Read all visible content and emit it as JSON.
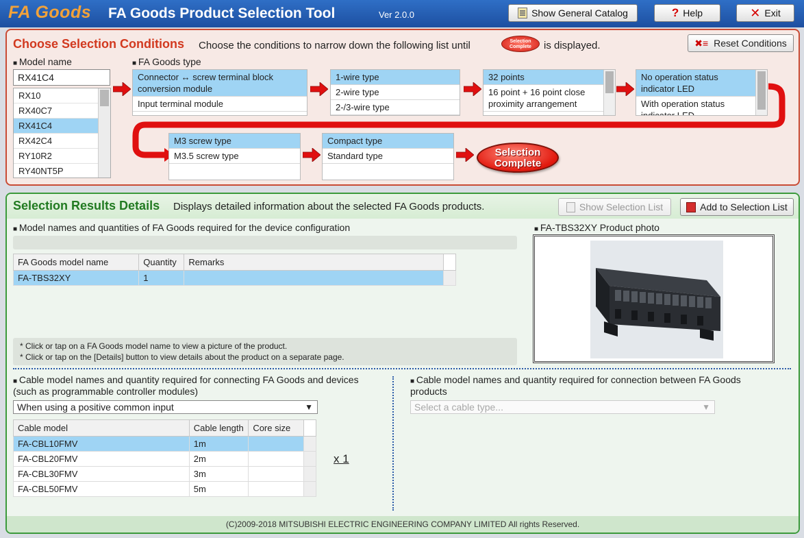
{
  "app": {
    "logo": "FA Goods",
    "title": "FA Goods Product Selection Tool",
    "version": "Ver 2.0.0",
    "catalog_label": "Show General Catalog",
    "help_label": "Help",
    "exit_label": "Exit"
  },
  "conditions": {
    "title": "Choose Selection Conditions",
    "desc_before": "Choose the conditions to narrow down the following list until",
    "desc_after": "is displayed.",
    "badge_text": "Selection Complete",
    "reset_label": "Reset Conditions",
    "model_label": "Model name",
    "model_value": "RX41C4",
    "models": [
      "RX10",
      "RX40C7",
      "RX41C4",
      "RX42C4",
      "RY10R2",
      "RY40NT5P"
    ],
    "selected_model_index": 2,
    "type_label": "FA Goods type",
    "type_options": [
      "Connector ↔ screw terminal block conversion module",
      "Input terminal module"
    ],
    "wire_options": [
      "1-wire type",
      "2-wire type",
      "2-/3-wire type"
    ],
    "points_options": [
      "32 points",
      "16 point + 16 point close proximity arrangement"
    ],
    "led_options": [
      "No operation status indicator LED",
      "With operation status indicator LED"
    ],
    "screw_options": [
      "M3 screw type",
      "M3.5 screw type"
    ],
    "size_options": [
      "Compact type",
      "Standard type"
    ],
    "complete_line1": "Selection",
    "complete_line2": "Complete"
  },
  "results": {
    "title": "Selection Results Details",
    "desc": "Displays detailed information about the selected FA Goods products.",
    "show_list_label": "Show Selection List",
    "add_list_label": "Add to Selection List",
    "required_label": "Model names and quantities of FA Goods required for the device configuration",
    "goods_table": {
      "headers": [
        "FA Goods model name",
        "Quantity",
        "Remarks"
      ],
      "rows": [
        [
          "FA-TBS32XY",
          "1",
          ""
        ]
      ]
    },
    "photo_label": "FA-TBS32XY Product photo",
    "note1": "* Click or tap on a FA Goods model name to view a picture of the product.",
    "note2": "* Click or tap on the [Details] button to view details about the product on a separate page.",
    "cable_label_l1": "Cable model names and quantity required for connecting FA Goods and devices",
    "cable_label_l2": "(such as programmable controller modules)",
    "cable_select_value": "When using a positive common input",
    "cable_table": {
      "headers": [
        "Cable model",
        "Cable length",
        "Core size"
      ],
      "rows": [
        [
          "FA-CBL10FMV",
          "1m",
          ""
        ],
        [
          "FA-CBL20FMV",
          "2m",
          ""
        ],
        [
          "FA-CBL30FMV",
          "3m",
          ""
        ],
        [
          "FA-CBL50FMV",
          "5m",
          ""
        ]
      ]
    },
    "multiplier": "x 1",
    "between_label_l1": "Cable model names and quantity required for connection between FA Goods",
    "between_label_l2": "products",
    "between_placeholder": "Select a cable type...",
    "footer": "(C)2009-2018 MITSUBISHI ELECTRIC ENGINEERING COMPANY LIMITED All rights Reserved."
  }
}
